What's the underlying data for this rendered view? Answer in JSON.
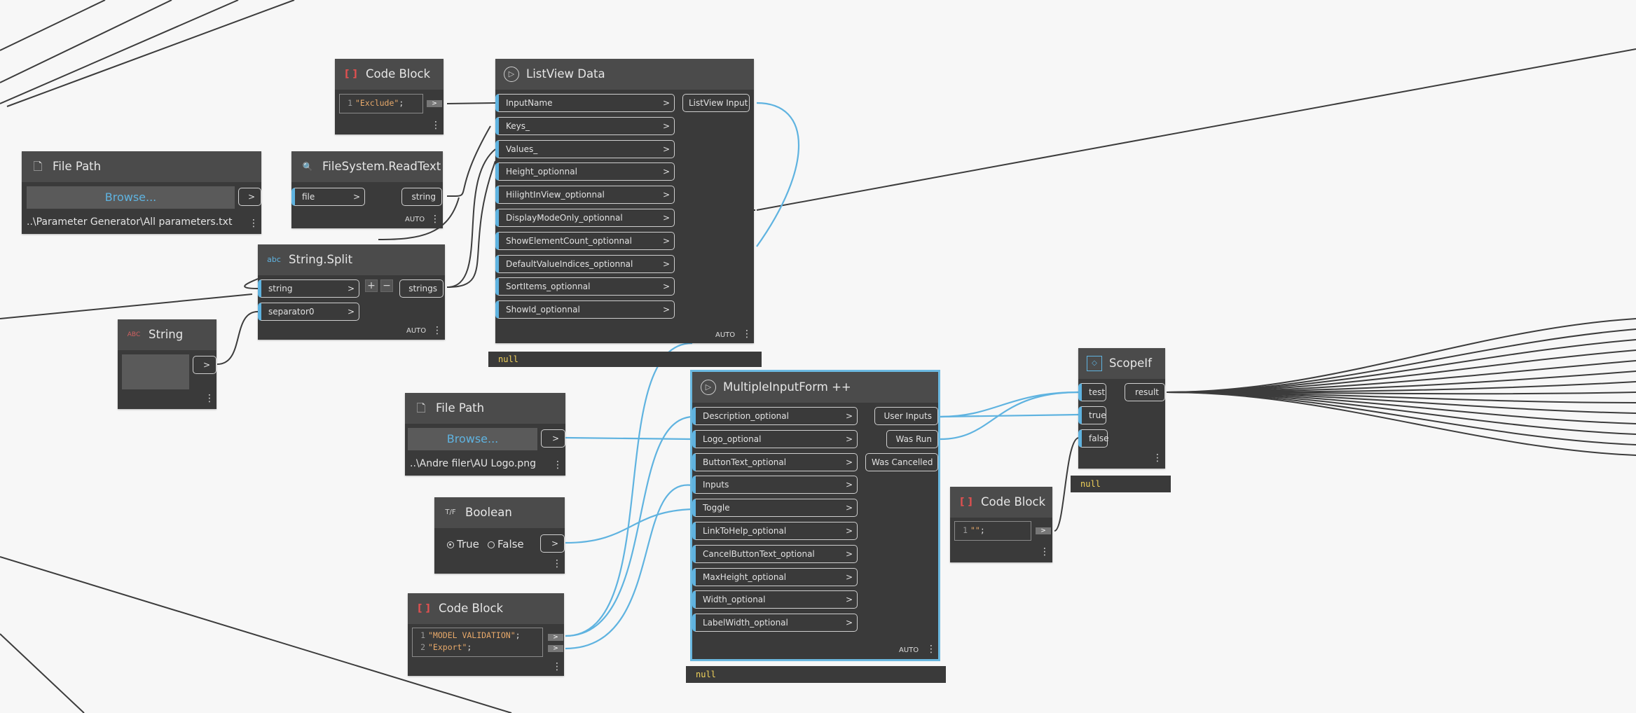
{
  "nodes": {
    "code_block_exclude": {
      "title": "Code Block",
      "line_no": "1",
      "code_str": "\"Exclude\"",
      "code_end": ";",
      "out_arrow": ">"
    },
    "listview_data": {
      "title": "ListView Data",
      "inputs": [
        "InputName",
        "Keys_",
        "Values_",
        "Height_optionnal",
        "HilightInView_optionnal",
        "DisplayModeOnly_optionnal",
        "ShowElementCount_optionnal",
        "DefaultValueIndices_optionnal",
        "SortItems_optionnal",
        "ShowId_optionnal"
      ],
      "output": "ListView Input",
      "lacing": "AUTO",
      "preview": "null"
    },
    "file_path_1": {
      "title": "File Path",
      "browse": "Browse...",
      "out_arrow": ">",
      "path": "..\\Parameter Generator\\All parameters.txt"
    },
    "filesystem_readtext": {
      "title": "FileSystem.ReadText",
      "input": "file",
      "output": "string",
      "lacing": "AUTO"
    },
    "string_split": {
      "title": "String.Split",
      "inputs": [
        "string",
        "separator0"
      ],
      "output": "strings",
      "add_btn": "+",
      "remove_btn": "−",
      "lacing": "AUTO",
      "icon": "abc"
    },
    "string_node": {
      "title": "String",
      "icon": "ABC",
      "out_arrow": ">"
    },
    "file_path_2": {
      "title": "File Path",
      "browse": "Browse...",
      "out_arrow": ">",
      "path": "..\\Andre filer\\AU Logo.png"
    },
    "boolean_node": {
      "title": "Boolean",
      "icon": "T/F",
      "true_label": "True",
      "false_label": "False",
      "selected": "True",
      "out_arrow": ">"
    },
    "code_block_model": {
      "title": "Code Block",
      "lines": [
        {
          "no": "1",
          "str": "\"MODEL VALIDATION\"",
          "end": ";"
        },
        {
          "no": "2",
          "str": "\"Export\"",
          "end": ";"
        }
      ],
      "out_arrow": ">"
    },
    "multiple_input_form": {
      "title": "MultipleInputForm ++",
      "inputs": [
        "Description_optional",
        "Logo_optional",
        "ButtonText_optional",
        "Inputs",
        "Toggle",
        "LinkToHelp_optional",
        "CancelButtonText_optional",
        "MaxHeight_optional",
        "Width_optional",
        "LabelWidth_optional"
      ],
      "outputs": [
        "User Inputs",
        "Was Run",
        "Was Cancelled"
      ],
      "lacing": "AUTO",
      "preview": "null"
    },
    "code_block_empty": {
      "title": "Code Block",
      "line_no": "1",
      "code_str": "\"\"",
      "code_end": ";",
      "out_arrow": ">"
    },
    "scope_if": {
      "title": "ScopeIf",
      "inputs": [
        "test",
        "true",
        "false"
      ],
      "output": "result",
      "preview": "null"
    }
  },
  "colors": {
    "canvas": "#f7f7f7",
    "node_body": "#3a3a3a",
    "node_header": "#4b4b4b",
    "port_connected": "#5fb3e0",
    "wire_blue": "#5fb3e0",
    "wire_dark": "#3c3c3c",
    "preview_text": "#f2d35a",
    "code_string": "#e8a96a"
  },
  "icons": {
    "more_menu": "vertical-ellipsis-icon",
    "listview_node": "listview-node-icon",
    "file_node": "file-icon",
    "read_node": "magnifier-icon",
    "code_node": "code-brackets-icon",
    "scopeif_node": "scope-if-icon"
  }
}
